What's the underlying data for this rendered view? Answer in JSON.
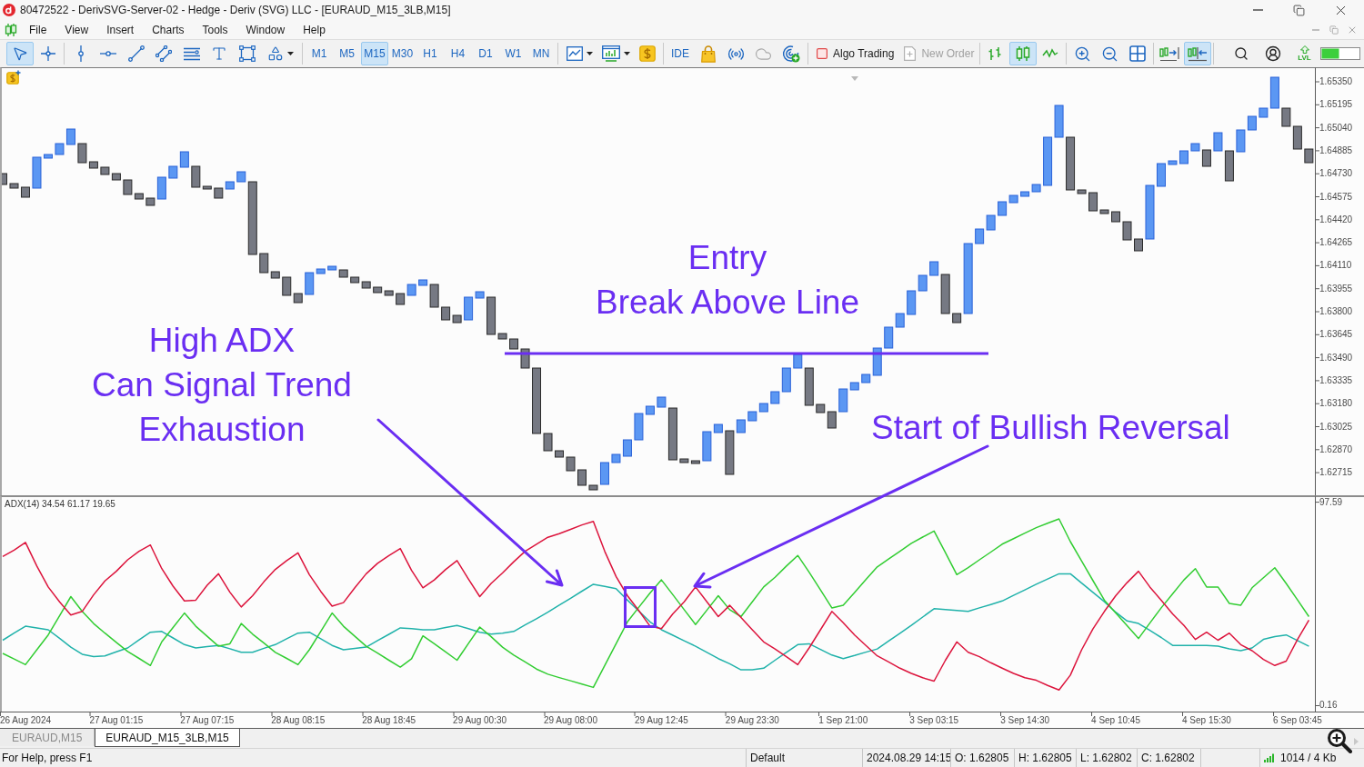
{
  "window": {
    "title": "80472522 - DerivSVG-Server-02 - Hedge - Deriv (SVG) LLC - [EURAUD_M15_3LB,M15]"
  },
  "menu": [
    "File",
    "View",
    "Insert",
    "Charts",
    "Tools",
    "Window",
    "Help"
  ],
  "toolbar": {
    "tools": [
      {
        "kind": "cursor",
        "selected": true
      },
      {
        "kind": "crosshair",
        "selected": false
      },
      {
        "kind": "vertical_line",
        "selected": false
      },
      {
        "kind": "horizontal_line",
        "selected": false
      },
      {
        "kind": "trend_line",
        "selected": false
      },
      {
        "kind": "channel",
        "selected": false
      },
      {
        "kind": "fibonacci",
        "selected": false
      },
      {
        "kind": "text",
        "selected": false
      },
      {
        "kind": "rectangle",
        "selected": false
      },
      {
        "kind": "shapes",
        "selected": false
      }
    ],
    "timeframes": [
      {
        "label": "M1",
        "selected": false
      },
      {
        "label": "M5",
        "selected": false
      },
      {
        "label": "M15",
        "selected": true
      },
      {
        "label": "M30",
        "selected": false
      },
      {
        "label": "H1",
        "selected": false
      },
      {
        "label": "H4",
        "selected": false
      },
      {
        "label": "D1",
        "selected": false
      },
      {
        "label": "W1",
        "selected": false
      },
      {
        "label": "MN",
        "selected": false
      }
    ],
    "ide": {
      "label": "IDE"
    },
    "algo_trading": {
      "label": "Algo Trading",
      "on": false
    },
    "new_order": {
      "label": "New Order",
      "disabled": true
    },
    "chart_types": [
      {
        "kind": "bars",
        "selected": false
      },
      {
        "kind": "candles",
        "selected": true
      },
      {
        "kind": "line",
        "selected": false
      }
    ],
    "scroll_modes": [
      {
        "kind": "autoscroll",
        "selected": false
      },
      {
        "kind": "shift",
        "selected": true
      }
    ],
    "levels_label": "LVL"
  },
  "chart": {
    "price_axis": [
      "1.65350",
      "1.65195",
      "1.65040",
      "1.64885",
      "1.64730",
      "1.64575",
      "1.64420",
      "1.64265",
      "1.64110",
      "1.63955",
      "1.63800",
      "1.63645",
      "1.63490",
      "1.63335",
      "1.63180",
      "1.63025",
      "1.62870",
      "1.62715"
    ],
    "annotations": [
      {
        "text": "Entry\nBreak Above Line"
      },
      {
        "text": "High ADX\nCan Signal Trend\nExhaustion"
      },
      {
        "text": "Start of Bullish Reversal"
      }
    ]
  },
  "indicator": {
    "chart_data": {
      "type": "line",
      "title": "ADX(14) 34.54 61.17 19.65",
      "categories": [
        null,
        null,
        "26 Aug 2024",
        null,
        null,
        null,
        null,
        null,
        null,
        null,
        "27 Aug 01:15",
        null,
        null,
        null,
        null,
        null,
        null,
        null,
        "27 Aug 07:15",
        null,
        null,
        null,
        null,
        null,
        null,
        null,
        "28 Aug 08:15",
        null,
        null,
        null,
        null,
        null,
        null,
        null,
        "28 Aug 18:45",
        null,
        null,
        null,
        null,
        null,
        null,
        null,
        "29 Aug 00:30",
        null,
        null,
        null,
        null,
        null,
        null,
        null,
        "29 Aug 08:00",
        null,
        null,
        null,
        null,
        null,
        null,
        null,
        "29 Aug 12:45",
        null,
        null,
        null,
        null,
        null,
        null,
        null,
        "29 Aug 23:30",
        null,
        null,
        null,
        null,
        null,
        null,
        null,
        "1 Sep 21:00",
        null,
        null,
        null,
        null,
        null,
        null,
        null,
        "3 Sep 03:15",
        null,
        null,
        null,
        null,
        null,
        null,
        null,
        "3 Sep 14:30",
        null,
        null,
        null,
        null,
        null,
        null,
        null,
        "4 Sep 10:45",
        null,
        null,
        null,
        null,
        null,
        null,
        null,
        "4 Sep 15:30",
        null,
        null,
        null,
        null,
        null,
        null,
        null,
        "6 Sep 03:45",
        null
      ],
      "ylim": [
        -2.67,
        100.9
      ],
      "yticks": [
        97.59,
        0.16
      ],
      "series": [
        {
          "color": "#20b2aa",
          "values": [
            31.5,
            34.9,
            38.2,
            37.4,
            36.5,
            32.4,
            28.2,
            24.8,
            23.6,
            24.0,
            25.9,
            27.8,
            31.6,
            35.3,
            35.7,
            32.6,
            29.4,
            27.8,
            28.4,
            29.0,
            27.4,
            25.7,
            25.7,
            27.6,
            29.4,
            32.2,
            34.9,
            35.3,
            32.2,
            29.0,
            26.9,
            27.6,
            28.2,
            31.3,
            34.3,
            37.4,
            37.0,
            36.5,
            36.5,
            37.6,
            38.6,
            37.0,
            35.3,
            34.4,
            34.9,
            35.7,
            38.8,
            41.8,
            44.9,
            48.3,
            51.6,
            55.0,
            58.3,
            57.3,
            56.2,
            50.7,
            45.5,
            40.3,
            36.5,
            33.9,
            31.2,
            28.6,
            25.7,
            22.7,
            20.2,
            17.3,
            17.3,
            18.1,
            21.9,
            25.7,
            29.4,
            29.8,
            27.1,
            24.4,
            22.7,
            24.2,
            25.8,
            27.3,
            31.1,
            34.8,
            38.6,
            42.6,
            46.6,
            46.2,
            45.7,
            45.3,
            47.0,
            48.6,
            50.3,
            53.0,
            55.6,
            58.3,
            60.8,
            63.3,
            63.3,
            58.8,
            54.4,
            49.9,
            44.9,
            40.7,
            39.5,
            36.2,
            32.8,
            29.0,
            29.0,
            29.0,
            29.0,
            28.6,
            27.3,
            26.5,
            27.8,
            31.9,
            33.2,
            34.0,
            31.3,
            28.6
          ]
        },
        {
          "color": "#32cd32",
          "values": [
            25.2,
            22.5,
            19.8,
            26.9,
            34.0,
            43.2,
            52.4,
            45.3,
            39.5,
            34.9,
            30.5,
            26.1,
            22.8,
            19.4,
            30.7,
            37.6,
            44.5,
            38.2,
            33.4,
            28.6,
            29.8,
            39.5,
            34.4,
            30.1,
            25.7,
            22.8,
            19.8,
            26.9,
            35.7,
            44.5,
            38.2,
            33.4,
            28.6,
            25.3,
            21.9,
            18.6,
            22.6,
            33.6,
            29.8,
            25.9,
            21.9,
            29.9,
            37.8,
            33.2,
            28.2,
            24.4,
            21.1,
            17.7,
            15.2,
            13.6,
            12.1,
            10.5,
            8.9,
            19.4,
            29.8,
            40.3,
            47.2,
            54.1,
            60.4,
            53.3,
            46.1,
            39.0,
            45.9,
            52.8,
            46.1,
            42.8,
            49.9,
            57.0,
            61.6,
            67.0,
            72.1,
            64.1,
            55.6,
            47.0,
            48.2,
            54.3,
            60.5,
            66.6,
            70.4,
            74.1,
            77.9,
            80.9,
            83.8,
            73.4,
            62.9,
            66.2,
            70.0,
            73.7,
            77.5,
            80.1,
            82.8,
            85.4,
            87.5,
            89.6,
            78.7,
            69.4,
            60.0,
            50.7,
            44.6,
            38.4,
            32.3,
            39.7,
            47.0,
            53.7,
            60.4,
            65.8,
            57.0,
            57.0,
            49.1,
            48.2,
            56.6,
            61.4,
            66.2,
            58.7,
            50.8,
            42.8
          ]
        },
        {
          "color": "#dc143c",
          "values": [
            71.6,
            74.6,
            78.3,
            67.0,
            57.0,
            49.9,
            43.6,
            45.3,
            53.2,
            59.9,
            64.5,
            70.0,
            74.1,
            77.1,
            65.8,
            57.4,
            50.3,
            50.7,
            57.8,
            63.3,
            54.5,
            47.4,
            52.8,
            59.5,
            65.4,
            69.6,
            73.3,
            62.9,
            54.9,
            47.8,
            49.5,
            56.6,
            63.3,
            68.3,
            72.0,
            75.4,
            64.9,
            56.6,
            60.4,
            65.4,
            69.6,
            60.8,
            52.4,
            58.7,
            63.7,
            69.1,
            74.1,
            77.5,
            80.8,
            82.5,
            84.6,
            86.7,
            88.4,
            74.1,
            62.0,
            52.8,
            45.7,
            38.2,
            37.0,
            44.1,
            49.9,
            57.0,
            49.9,
            42.8,
            48.2,
            42.4,
            36.5,
            30.7,
            27.3,
            23.6,
            19.8,
            27.8,
            36.5,
            45.3,
            39.9,
            34.0,
            29.0,
            24.0,
            21.1,
            18.1,
            15.6,
            13.5,
            11.9,
            21.9,
            30.7,
            25.7,
            23.6,
            20.7,
            18.1,
            15.6,
            13.5,
            12.3,
            9.8,
            7.7,
            14.8,
            26.9,
            37.0,
            45.3,
            52.8,
            59.1,
            64.5,
            57.0,
            50.7,
            44.1,
            38.6,
            31.9,
            35.3,
            31.5,
            34.9,
            29.4,
            26.5,
            22.3,
            19.4,
            21.5,
            31.9,
            41.1
          ]
        }
      ]
    }
  },
  "tabs": [
    {
      "label": "EURAUD,M15",
      "selected": false
    },
    {
      "label": "EURAUD_M15_3LB,M15",
      "selected": true
    }
  ],
  "status_bar": {
    "help": "For Help, press F1",
    "fields": [
      "Default",
      "2024.08.29 14:15",
      "O: 1.62805",
      "H: 1.62805",
      "L: 1.62802",
      "C: 1.62802"
    ],
    "traffic": "1014 / 4 Kb"
  }
}
